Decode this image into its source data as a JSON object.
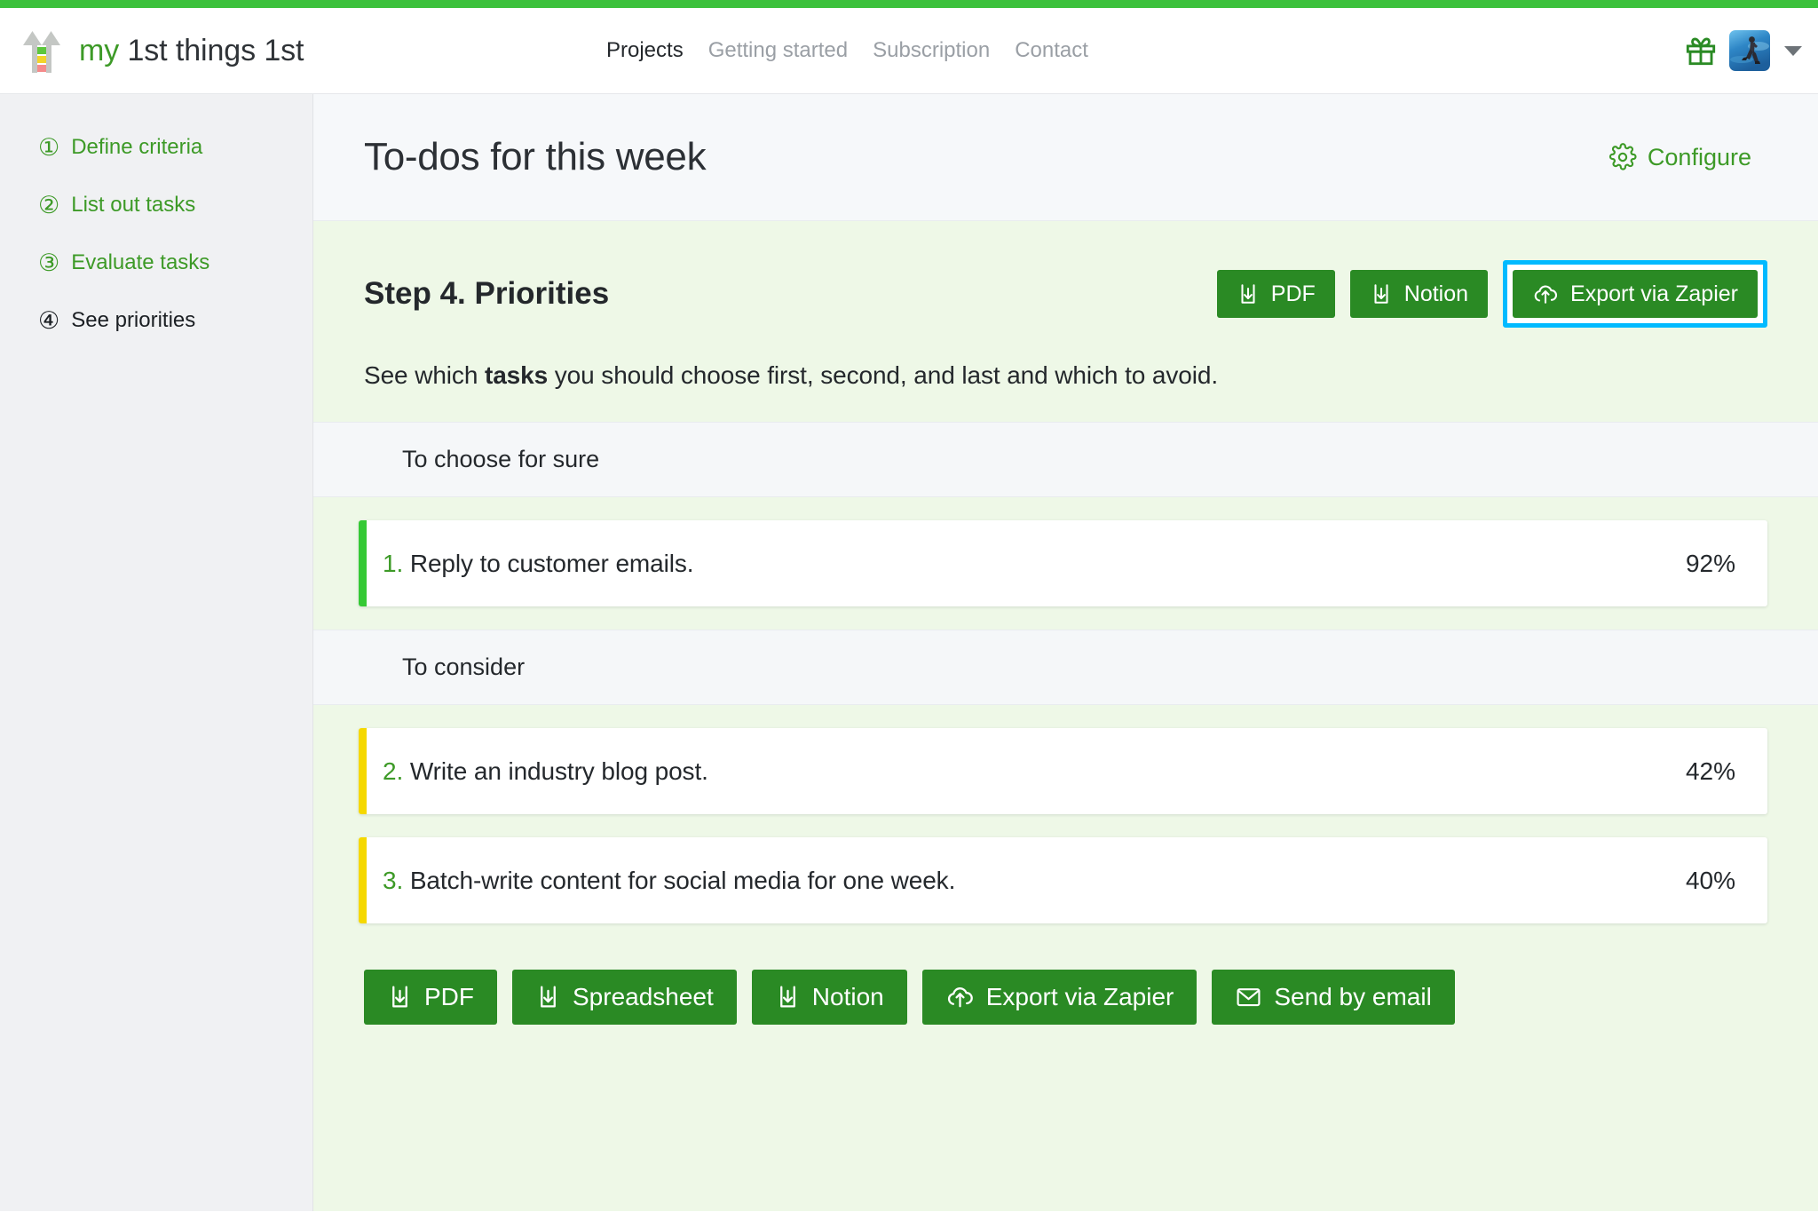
{
  "brand": {
    "word_my": "my",
    "word_rest": " 1st things 1st",
    "logo_icon": "two-up-arrows-logo"
  },
  "nav": {
    "items": [
      {
        "label": "Projects",
        "active": true
      },
      {
        "label": "Getting started",
        "active": false
      },
      {
        "label": "Subscription",
        "active": false
      },
      {
        "label": "Contact",
        "active": false
      }
    ]
  },
  "header_right": {
    "gift_icon": "gift-icon",
    "avatar_icon": "user-avatar-running-person",
    "caret_icon": "chevron-down-icon"
  },
  "sidebar": {
    "steps": [
      {
        "num": "①",
        "label": "Define criteria",
        "state": "done"
      },
      {
        "num": "②",
        "label": "List out tasks",
        "state": "done"
      },
      {
        "num": "③",
        "label": "Evaluate tasks",
        "state": "done"
      },
      {
        "num": "④",
        "label": "See priorities",
        "state": "current"
      }
    ]
  },
  "page": {
    "title": "To-dos for this week",
    "configure_label": "Configure",
    "configure_icon": "gear-icon"
  },
  "step_panel": {
    "title": "Step 4. Priorities",
    "description_pre": "See which ",
    "description_bold": "tasks",
    "description_post": " you should choose first, second, and last and which to avoid.",
    "top_actions": [
      {
        "label": "PDF",
        "icon": "download-icon",
        "highlighted": false
      },
      {
        "label": "Notion",
        "icon": "download-icon",
        "highlighted": false
      },
      {
        "label": "Export via Zapier",
        "icon": "cloud-upload-icon",
        "highlighted": true
      }
    ],
    "bottom_actions": [
      {
        "label": "PDF",
        "icon": "download-icon"
      },
      {
        "label": "Spreadsheet",
        "icon": "download-icon"
      },
      {
        "label": "Notion",
        "icon": "download-icon"
      },
      {
        "label": "Export via Zapier",
        "icon": "cloud-upload-icon"
      },
      {
        "label": "Send by email",
        "icon": "envelope-icon"
      }
    ],
    "groups": [
      {
        "heading": "To choose for sure",
        "edge_color": "#35c935",
        "tasks": [
          {
            "rank": "1.",
            "label": "Reply to customer emails.",
            "score": "92%"
          }
        ]
      },
      {
        "heading": "To consider",
        "edge_color": "#f5d800",
        "tasks": [
          {
            "rank": "2.",
            "label": "Write an industry blog post.",
            "score": "42%"
          },
          {
            "rank": "3.",
            "label": "Batch-write content for social media for one week.",
            "score": "40%"
          }
        ]
      }
    ]
  },
  "colors": {
    "accent_green": "#3cc13c",
    "button_green": "#2a8a24",
    "link_green": "#3d9a27",
    "highlight_cyan": "#00baff",
    "panel_bg": "#eef8e7",
    "edge_high": "#35c935",
    "edge_medium": "#f5d800"
  }
}
